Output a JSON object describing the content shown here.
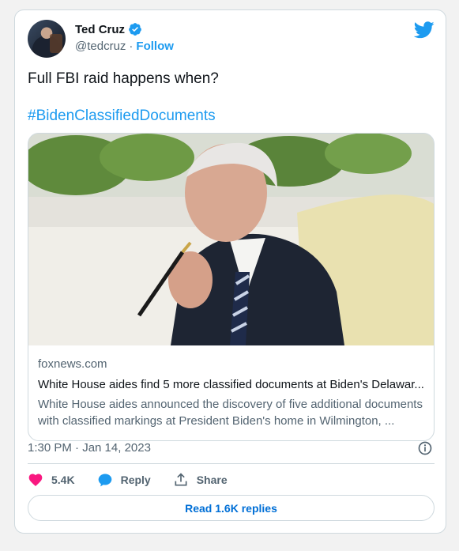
{
  "author": {
    "name": "Ted Cruz",
    "handle": "@tedcruz",
    "separator": "·",
    "follow_label": "Follow"
  },
  "tweet": {
    "text": "Full FBI raid happens when?",
    "hashtag": "#BidenClassifiedDocuments"
  },
  "link_card": {
    "domain": "foxnews.com",
    "title": "White House aides find 5 more classified documents at Biden's Delawar...",
    "description": "White House aides announced the discovery of five additional documents with classified markings at President Biden's home in Wilmington, ..."
  },
  "meta": {
    "timestamp": "1:30 PM · Jan 14, 2023"
  },
  "actions": {
    "likes": "5.4K",
    "reply_label": "Reply",
    "share_label": "Share"
  },
  "replies_button": "Read 1.6K replies",
  "icons": {
    "verified": "verified-badge-icon",
    "bird": "twitter-bird-icon",
    "info": "info-icon",
    "like": "heart-icon",
    "reply": "reply-bubble-icon",
    "share": "share-icon"
  },
  "colors": {
    "accent": "#1d9bf0",
    "like": "#f91880",
    "text_secondary": "#536471",
    "link_button": "#006fd6"
  }
}
